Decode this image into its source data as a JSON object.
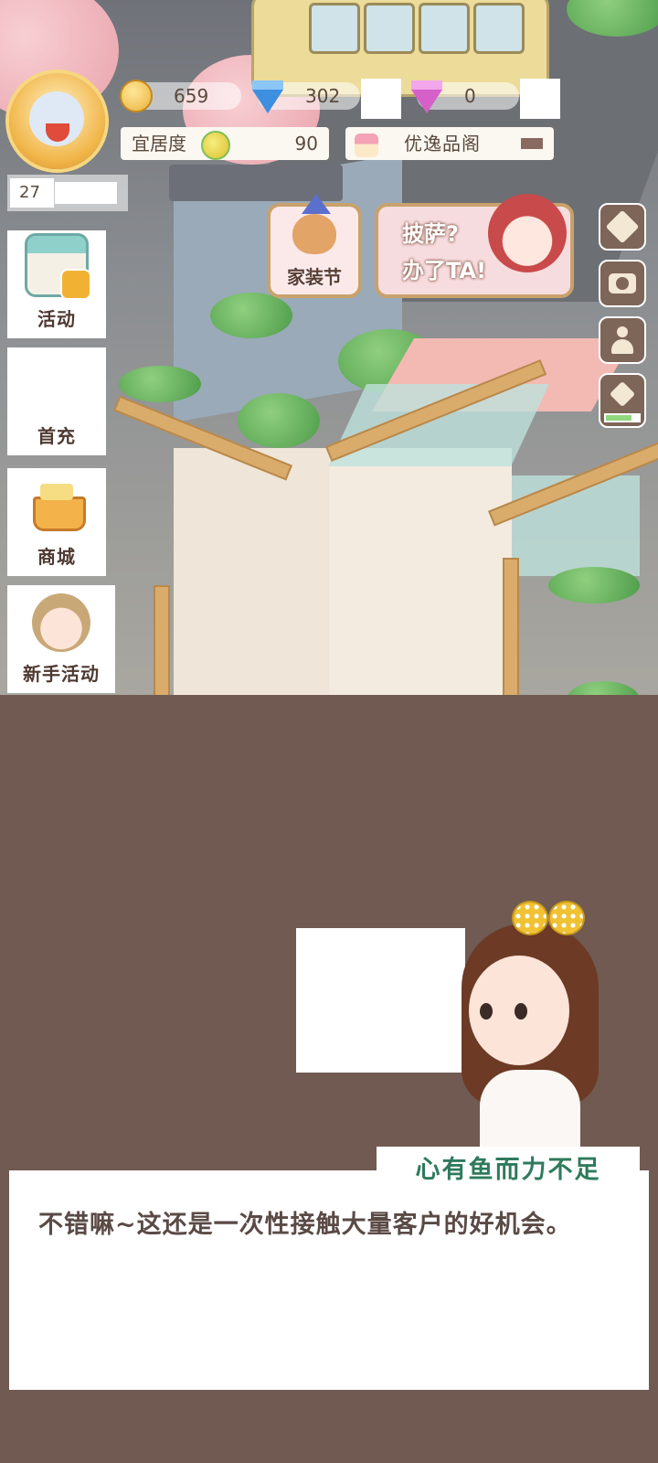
{
  "resources": {
    "coins": "659",
    "diamonds": "302",
    "pink_gems": "0"
  },
  "comfort": {
    "label": "宜居度",
    "value": "90"
  },
  "shop_link": {
    "label": "优逸品阁"
  },
  "player": {
    "level": "27"
  },
  "side_menu": [
    {
      "label": "活动",
      "icon": "calendar-gift-icon"
    },
    {
      "label": "首充",
      "icon": ""
    },
    {
      "label": "商城",
      "icon": "shopping-cart-icon"
    },
    {
      "label": "新手活动",
      "icon": "child-avatar-icon"
    }
  ],
  "events": {
    "home_festival": "家装节",
    "pizza_line1": "披萨?",
    "pizza_line2": "办了TA!"
  },
  "right_tools": [
    "box-icon",
    "camera-icon",
    "person-icon",
    "storage-icon"
  ],
  "dialogue": {
    "speaker": "心有鱼而力不足",
    "text": "不错嘛~这还是一次性接触大量客户的好机会。"
  },
  "colors": {
    "overlay": "#705a52",
    "speaker_name": "#2e7a5c",
    "dialog_text": "#5a4a46"
  }
}
